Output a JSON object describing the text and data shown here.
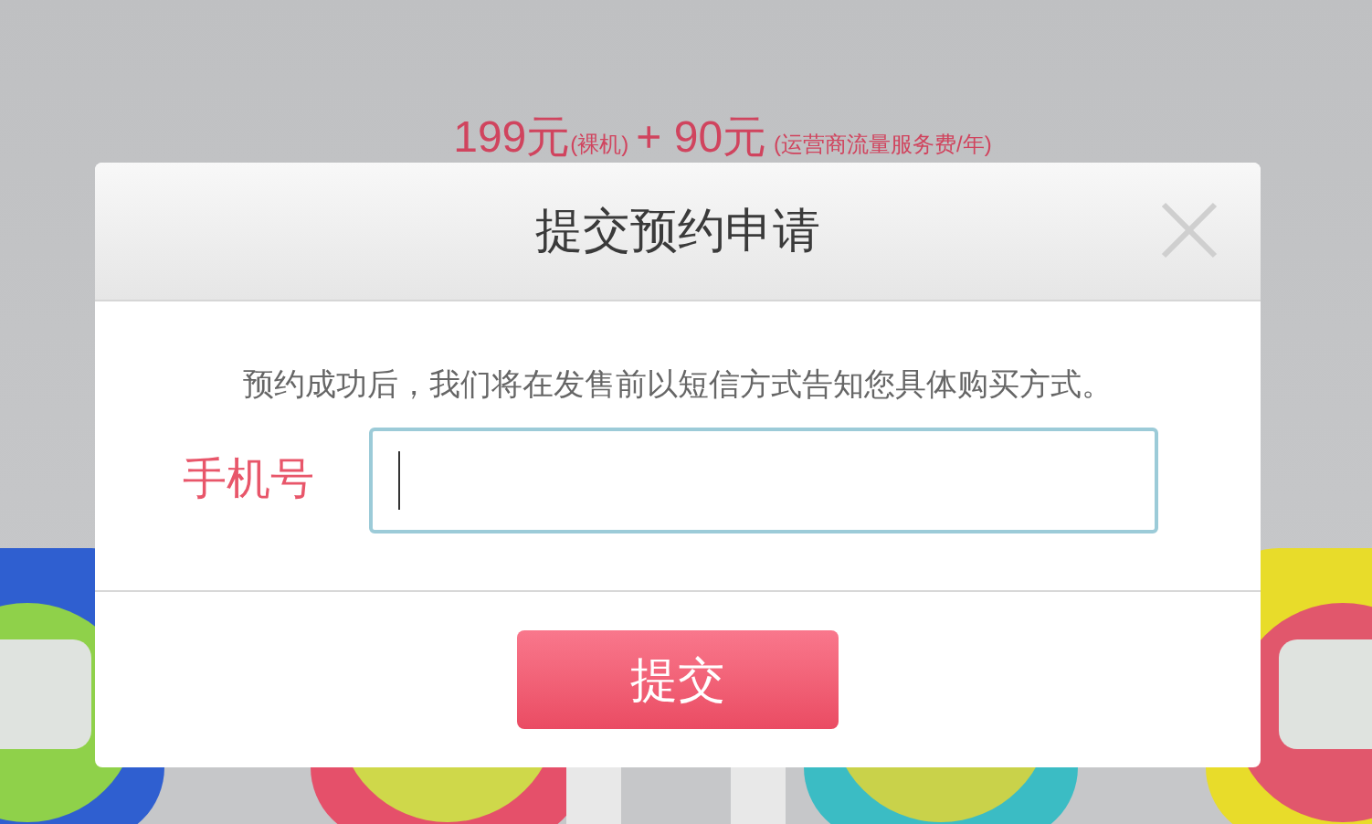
{
  "page": {
    "price": "199元",
    "price_note": "(裸机)",
    "addon": "+ 90元",
    "addon_note": "(运营商流量服务费/年)",
    "kind": "picture"
  },
  "dialog": {
    "title": "提交预约申请",
    "closable": true,
    "message": "预约成功后，我们将在发售前以短信方式告知您具体购买方式。",
    "phone_field": {
      "label": "手机号",
      "focused": true
    },
    "submit": "提交"
  }
}
